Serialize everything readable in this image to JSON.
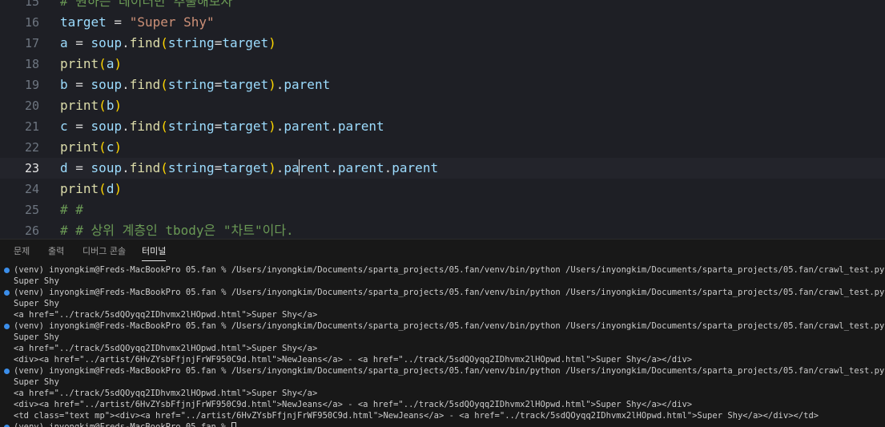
{
  "editor": {
    "lines": [
      {
        "num": "15",
        "tokens": [
          [
            "c",
            "# 원하는 데이터만 추출해보자"
          ]
        ]
      },
      {
        "num": "16",
        "tokens": [
          [
            "v",
            "target"
          ],
          [
            "o",
            " = "
          ],
          [
            "s",
            "\"Super Shy\""
          ]
        ]
      },
      {
        "num": "17",
        "tokens": [
          [
            "v",
            "a"
          ],
          [
            "o",
            " = "
          ],
          [
            "v",
            "soup"
          ],
          [
            "o",
            "."
          ],
          [
            "f",
            "find"
          ],
          [
            "p",
            "("
          ],
          [
            "v",
            "string"
          ],
          [
            "o",
            "="
          ],
          [
            "v",
            "target"
          ],
          [
            "p",
            ")"
          ]
        ]
      },
      {
        "num": "18",
        "tokens": [
          [
            "f",
            "print"
          ],
          [
            "p",
            "("
          ],
          [
            "v",
            "a"
          ],
          [
            "p",
            ")"
          ]
        ]
      },
      {
        "num": "19",
        "tokens": [
          [
            "v",
            "b"
          ],
          [
            "o",
            " = "
          ],
          [
            "v",
            "soup"
          ],
          [
            "o",
            "."
          ],
          [
            "f",
            "find"
          ],
          [
            "p",
            "("
          ],
          [
            "v",
            "string"
          ],
          [
            "o",
            "="
          ],
          [
            "v",
            "target"
          ],
          [
            "p",
            ")"
          ],
          [
            "o",
            "."
          ],
          [
            "v",
            "parent"
          ]
        ]
      },
      {
        "num": "20",
        "tokens": [
          [
            "f",
            "print"
          ],
          [
            "p",
            "("
          ],
          [
            "v",
            "b"
          ],
          [
            "p",
            ")"
          ]
        ]
      },
      {
        "num": "21",
        "tokens": [
          [
            "v",
            "c"
          ],
          [
            "o",
            " = "
          ],
          [
            "v",
            "soup"
          ],
          [
            "o",
            "."
          ],
          [
            "f",
            "find"
          ],
          [
            "p",
            "("
          ],
          [
            "v",
            "string"
          ],
          [
            "o",
            "="
          ],
          [
            "v",
            "target"
          ],
          [
            "p",
            ")"
          ],
          [
            "o",
            "."
          ],
          [
            "v",
            "parent"
          ],
          [
            "o",
            "."
          ],
          [
            "v",
            "parent"
          ]
        ]
      },
      {
        "num": "22",
        "tokens": [
          [
            "f",
            "print"
          ],
          [
            "p",
            "("
          ],
          [
            "v",
            "c"
          ],
          [
            "p",
            ")"
          ]
        ]
      },
      {
        "num": "23",
        "active": true,
        "tokens": [
          [
            "v",
            "d"
          ],
          [
            "o",
            " = "
          ],
          [
            "v",
            "soup"
          ],
          [
            "o",
            "."
          ],
          [
            "f",
            "find"
          ],
          [
            "p",
            "("
          ],
          [
            "v",
            "string"
          ],
          [
            "o",
            "="
          ],
          [
            "v",
            "target"
          ],
          [
            "p",
            ")"
          ],
          [
            "o",
            "."
          ],
          [
            "v",
            "pa"
          ],
          [
            "cursor",
            ""
          ],
          [
            "v",
            "rent"
          ],
          [
            "o",
            "."
          ],
          [
            "v",
            "parent"
          ],
          [
            "o",
            "."
          ],
          [
            "v",
            "parent"
          ]
        ]
      },
      {
        "num": "24",
        "tokens": [
          [
            "f",
            "print"
          ],
          [
            "p",
            "("
          ],
          [
            "v",
            "d"
          ],
          [
            "p",
            ")"
          ]
        ]
      },
      {
        "num": "25",
        "tokens": [
          [
            "c",
            "# #"
          ]
        ]
      },
      {
        "num": "26",
        "tokens": [
          [
            "c",
            "# # 상위 계층인 tbody은 \"차트\"이다."
          ]
        ]
      }
    ]
  },
  "panel": {
    "tabs": [
      {
        "label": "문제",
        "active": false
      },
      {
        "label": "출력",
        "active": false
      },
      {
        "label": "디버그 콘솔",
        "active": false
      },
      {
        "label": "터미널",
        "active": true
      }
    ]
  },
  "terminal": {
    "lines": [
      {
        "dot": true,
        "text": "(venv) inyongkim@Freds-MacBookPro 05.fan % /Users/inyongkim/Documents/sparta_projects/05.fan/venv/bin/python /Users/inyongkim/Documents/sparta_projects/05.fan/crawl_test.py"
      },
      {
        "dot": false,
        "text": "Super Shy"
      },
      {
        "dot": true,
        "text": "(venv) inyongkim@Freds-MacBookPro 05.fan % /Users/inyongkim/Documents/sparta_projects/05.fan/venv/bin/python /Users/inyongkim/Documents/sparta_projects/05.fan/crawl_test.py"
      },
      {
        "dot": false,
        "text": "Super Shy"
      },
      {
        "dot": false,
        "text": "<a href=\"../track/5sdQOyqq2IDhvmx2lHOpwd.html\">Super Shy</a>"
      },
      {
        "dot": true,
        "text": "(venv) inyongkim@Freds-MacBookPro 05.fan % /Users/inyongkim/Documents/sparta_projects/05.fan/venv/bin/python /Users/inyongkim/Documents/sparta_projects/05.fan/crawl_test.py"
      },
      {
        "dot": false,
        "text": "Super Shy"
      },
      {
        "dot": false,
        "text": "<a href=\"../track/5sdQOyqq2IDhvmx2lHOpwd.html\">Super Shy</a>"
      },
      {
        "dot": false,
        "text": "<div><a href=\"../artist/6HvZYsbFfjnjFrWF950C9d.html\">NewJeans</a> - <a href=\"../track/5sdQOyqq2IDhvmx2lHOpwd.html\">Super Shy</a></div>"
      },
      {
        "dot": true,
        "text": "(venv) inyongkim@Freds-MacBookPro 05.fan % /Users/inyongkim/Documents/sparta_projects/05.fan/venv/bin/python /Users/inyongkim/Documents/sparta_projects/05.fan/crawl_test.py"
      },
      {
        "dot": false,
        "text": "Super Shy"
      },
      {
        "dot": false,
        "text": "<a href=\"../track/5sdQOyqq2IDhvmx2lHOpwd.html\">Super Shy</a>"
      },
      {
        "dot": false,
        "text": "<div><a href=\"../artist/6HvZYsbFfjnjFrWF950C9d.html\">NewJeans</a> - <a href=\"../track/5sdQOyqq2IDhvmx2lHOpwd.html\">Super Shy</a></div>"
      },
      {
        "dot": false,
        "text": "<td class=\"text mp\"><div><a href=\"../artist/6HvZYsbFfjnjFrWF950C9d.html\">NewJeans</a> - <a href=\"../track/5sdQOyqq2IDhvmx2lHOpwd.html\">Super Shy</a></div></td>"
      },
      {
        "dot": true,
        "text": "(venv) inyongkim@Freds-MacBookPro 05.fan % ",
        "cursor": true
      }
    ]
  },
  "colors": {
    "editor_bg": "#1e1f25",
    "panel_bg": "#181818",
    "terminal_dot": "#3b8eea"
  }
}
